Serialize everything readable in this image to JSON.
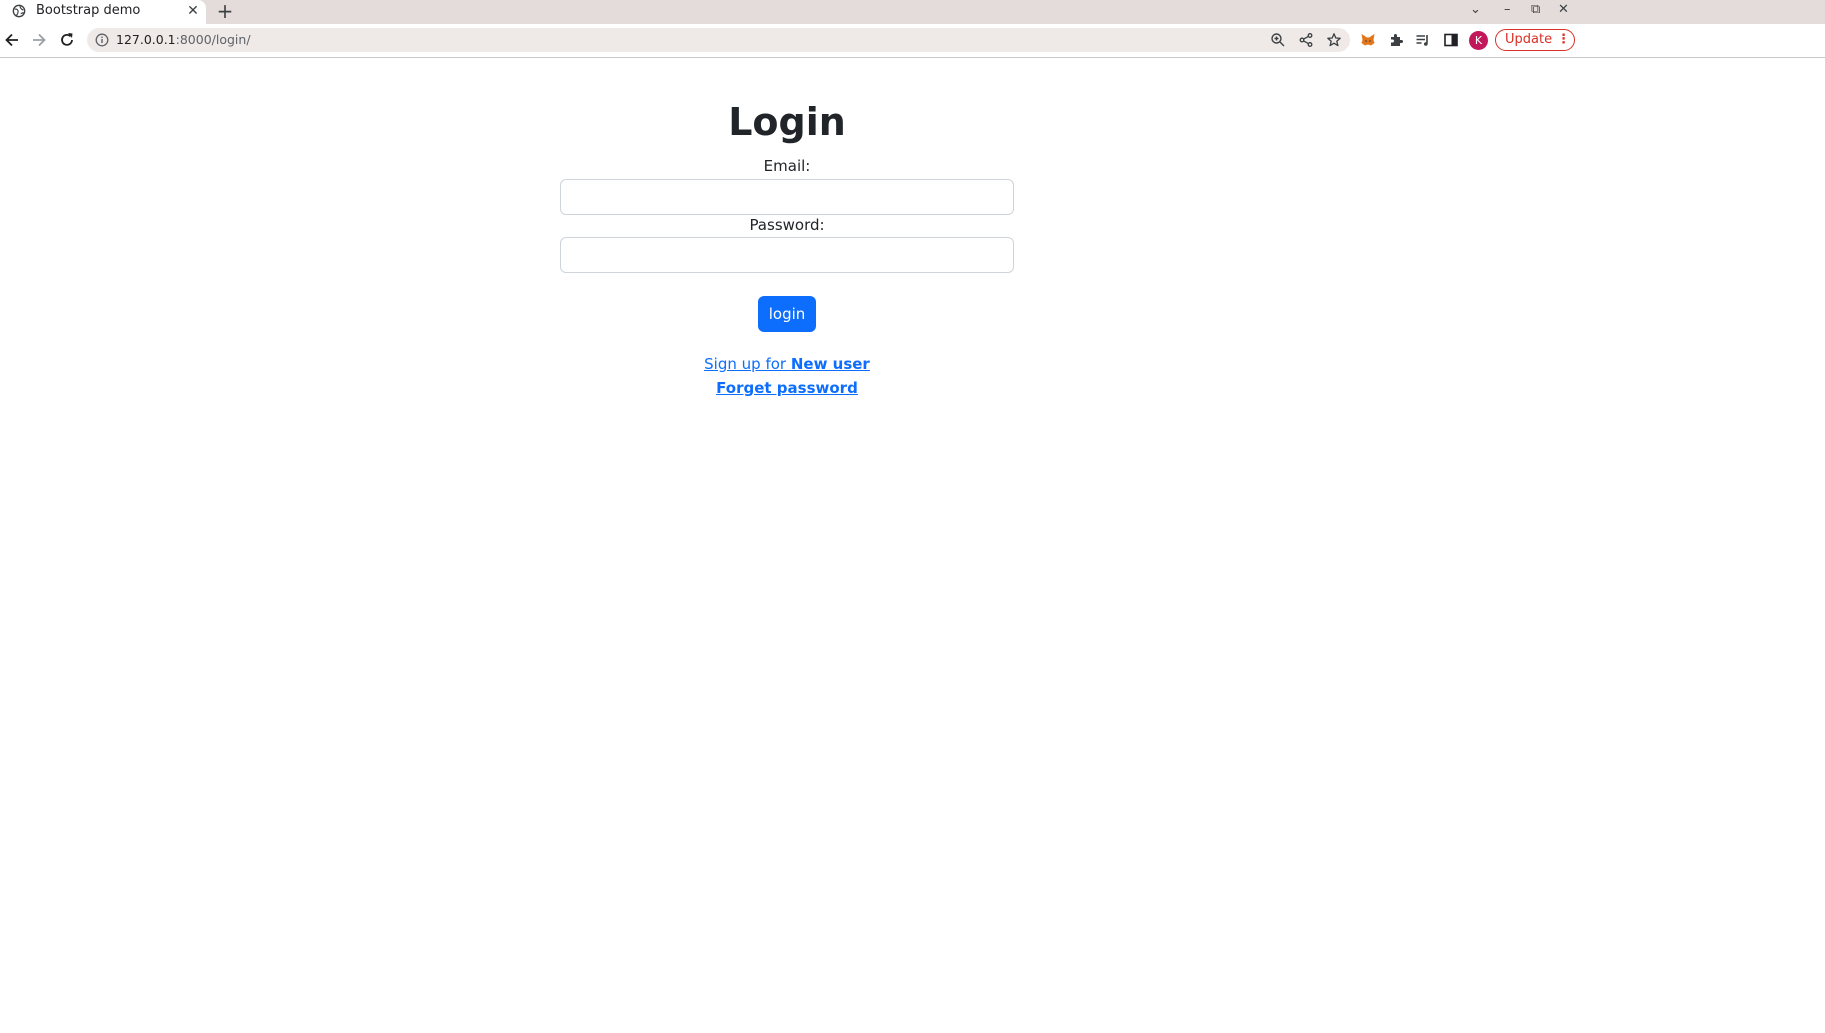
{
  "browser": {
    "tab_title": "Bootstrap demo",
    "tab_close_glyph": "✕",
    "new_tab_glyph": "+",
    "url_host": "127.0.0.1",
    "url_rest": ":8000/login/",
    "avatar_letter": "K",
    "update_label": "Update",
    "update_menu_glyph": "⋮",
    "window_controls": {
      "tabs_menu": "⌄",
      "minimize": "–",
      "restore": "⧉",
      "close": "✕"
    }
  },
  "login": {
    "title": "Login",
    "email_label": "Email:",
    "email_value": "",
    "password_label": "Password:",
    "password_value": "",
    "submit_label": "login",
    "signup_prefix": "Sign up for ",
    "signup_link": "New user",
    "forgot_link": "Forget password"
  },
  "colors": {
    "primary": "#0d6efd",
    "update_red": "#d93025",
    "avatar": "#c2185b",
    "tabstrip": "#e3dcda"
  }
}
